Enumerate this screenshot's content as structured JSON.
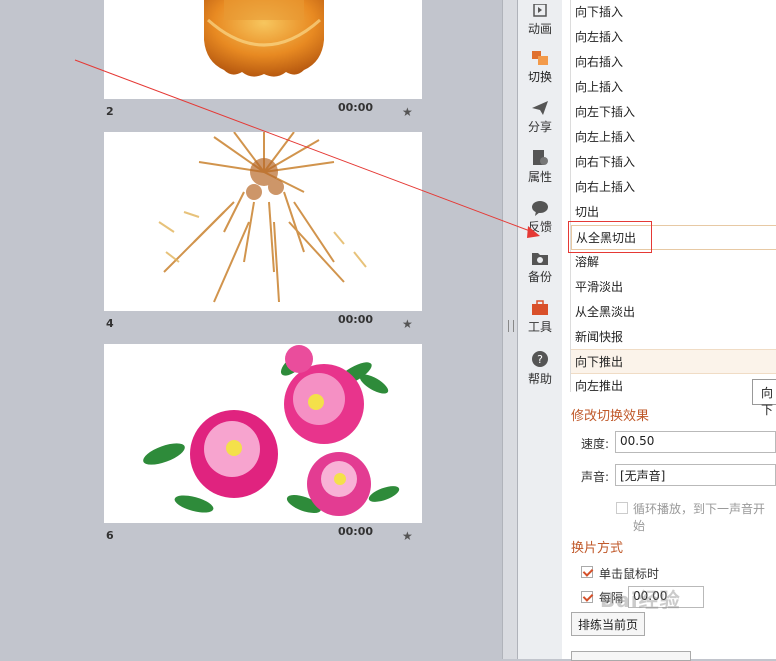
{
  "slides": [
    {
      "number": "2",
      "time": "00:00",
      "image": "mooncake"
    },
    {
      "number": "4",
      "time": "00:00",
      "image": "fireworks"
    },
    {
      "number": "6",
      "time": "00:00",
      "image": "peony-flowers"
    }
  ],
  "side_tabs": [
    {
      "label": "动画",
      "icon": "animation-icon"
    },
    {
      "label": "切换",
      "icon": "transition-icon"
    },
    {
      "label": "分享",
      "icon": "share-icon"
    },
    {
      "label": "属性",
      "icon": "properties-icon"
    },
    {
      "label": "反馈",
      "icon": "feedback-icon"
    },
    {
      "label": "备份",
      "icon": "backup-icon"
    },
    {
      "label": "工具",
      "icon": "toolbox-icon"
    },
    {
      "label": "帮助",
      "icon": "help-icon"
    }
  ],
  "effects": [
    "向下插入",
    "向左插入",
    "向右插入",
    "向上插入",
    "向左下插入",
    "向左上插入",
    "向右下插入",
    "向右上插入",
    "切出",
    "从全黑切出",
    "溶解",
    "平滑淡出",
    "从全黑淡出",
    "新闻快报",
    "向下推出",
    "向左推出"
  ],
  "selected_effect": "从全黑切出",
  "tooltip_text": "向下",
  "modify": {
    "title": "修改切换效果",
    "speed_label": "速度:",
    "speed_value": "00.50",
    "sound_label": "声音:",
    "sound_value": "[无声音]",
    "loop_label": "循环播放，到下一声音开始"
  },
  "advance": {
    "title": "换片方式",
    "on_click_label": "单击鼠标时",
    "auto_label": "每隔",
    "auto_value": "00.00",
    "rehearse_button": "排练当前页"
  },
  "watermark": "Bai经验",
  "colors": {
    "accent": "#c0592a",
    "highlight": "#e53935"
  }
}
